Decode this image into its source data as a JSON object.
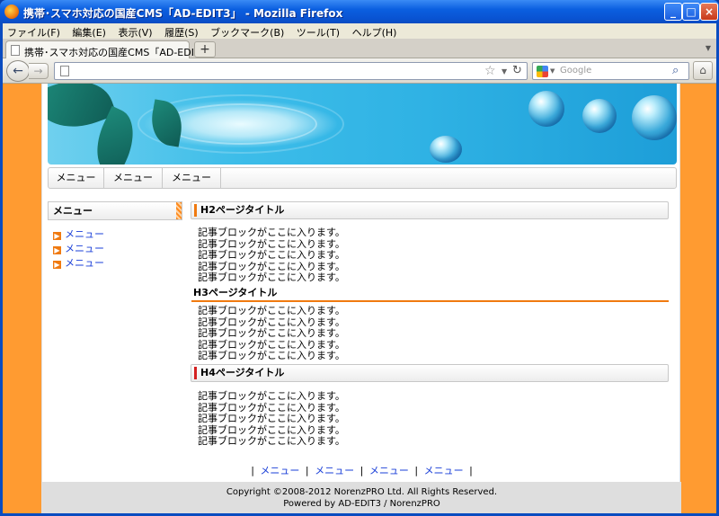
{
  "window": {
    "title": "携帯･スマホ対応の国産CMS「AD-EDIT3」 - Mozilla Firefox"
  },
  "menubar": [
    "ファイル(F)",
    "編集(E)",
    "表示(V)",
    "履歴(S)",
    "ブックマーク(B)",
    "ツール(T)",
    "ヘルプ(H)"
  ],
  "tab": {
    "label": "携帯･スマホ対応の国産CMS「AD-EDIT3」",
    "new_tab": "+"
  },
  "search": {
    "placeholder": "Google"
  },
  "gnav": [
    "メニュー",
    "メニュー",
    "メニュー"
  ],
  "sidebar": {
    "heading": "メニュー",
    "items": [
      "メニュー",
      "メニュー",
      "メニュー"
    ]
  },
  "content": {
    "h2": "H2ページタイトル",
    "h3": "H3ページタイトル",
    "h4": "H4ページタイトル",
    "block_line": "記事ブロックがここに入ります。"
  },
  "footnav": [
    "メニュー",
    "メニュー",
    "メニュー",
    "メニュー"
  ],
  "footnav_sep": "|",
  "footer": {
    "copyright": "Copyright ©2008-2012 NorenzPRO Ltd. All Rights Reserved.",
    "powered": "Powered by AD-EDIT3 / NorenzPRO"
  },
  "colors": {
    "accent": "#ff9b31",
    "link": "#1a3fd8",
    "h4_bar": "#d42020"
  }
}
